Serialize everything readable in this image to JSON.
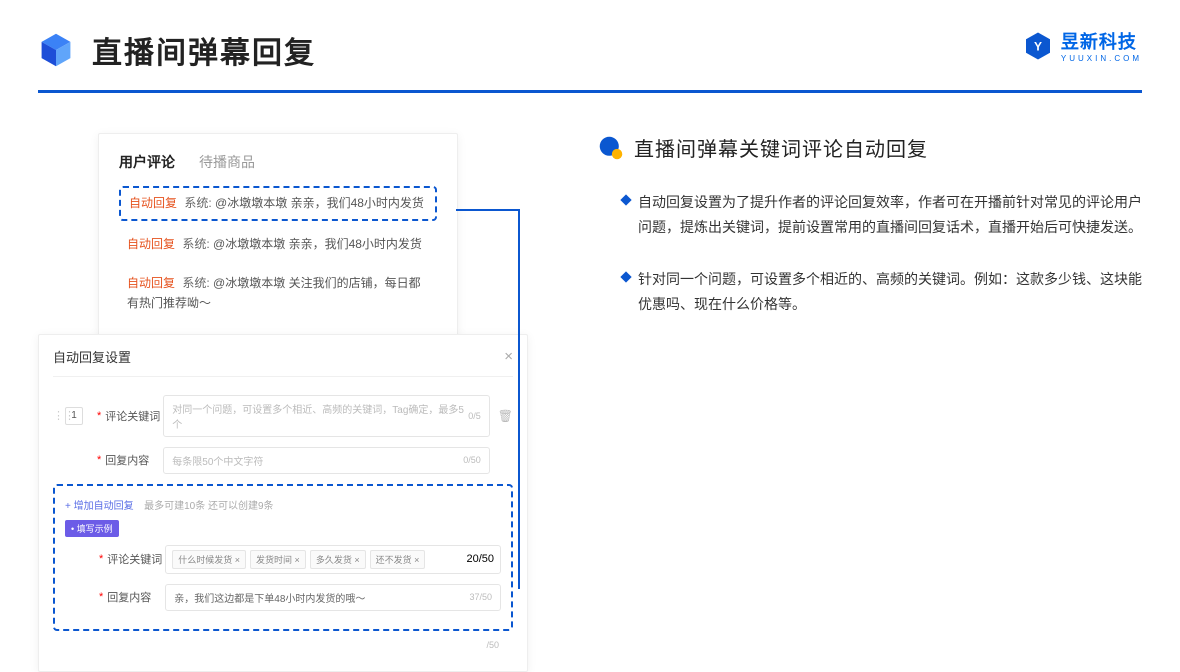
{
  "header": {
    "title": "直播间弹幕回复"
  },
  "brand": {
    "name": "昱新科技",
    "domain": "YUUXIN.COM"
  },
  "comments": {
    "tabs": {
      "active": "用户评论",
      "inactive": "待播商品"
    },
    "rows": [
      {
        "label": "自动回复",
        "prefix": "系统:",
        "text": "@冰墩墩本墩 亲亲，我们48小时内发货"
      },
      {
        "label": "自动回复",
        "prefix": "系统:",
        "text": "@冰墩墩本墩 亲亲，我们48小时内发货"
      },
      {
        "label": "自动回复",
        "prefix": "系统:",
        "text": "@冰墩墩本墩 关注我们的店铺，每日都有热门推荐呦～"
      }
    ]
  },
  "settings": {
    "title": "自动回复设置",
    "seq": "1",
    "kw_label": "评论关键词",
    "kw_placeholder": "对同一个问题，可设置多个相近、高频的关键词，Tag确定，最多5个",
    "kw_count": "0/5",
    "rc_label": "回复内容",
    "rc_placeholder": "每条限50个中文字符",
    "rc_count": "0/50",
    "add_text": "+ 增加自动回复",
    "add_note": "最多可建10条 还可以创建9条",
    "example_badge": "• 填写示例",
    "ex_kw_label": "评论关键词",
    "ex_tags": [
      "什么时候发货 ×",
      "发货时间 ×",
      "多久发货 ×",
      "还不发货 ×"
    ],
    "ex_kw_count": "20/50",
    "ex_rc_label": "回复内容",
    "ex_rc_text": "亲，我们这边都是下单48小时内发货的哦～",
    "ex_rc_count": "37/50",
    "outer_count": "/50"
  },
  "right": {
    "title": "直播间弹幕关键词评论自动回复",
    "bullets": [
      "自动回复设置为了提升作者的评论回复效率，作者可在开播前针对常见的评论用户问题，提炼出关键词，提前设置常用的直播间回复话术，直播开始后可快捷发送。",
      "针对同一个问题，可设置多个相近的、高频的关键词。例如：这款多少钱、这块能优惠吗、现在什么价格等。"
    ]
  }
}
